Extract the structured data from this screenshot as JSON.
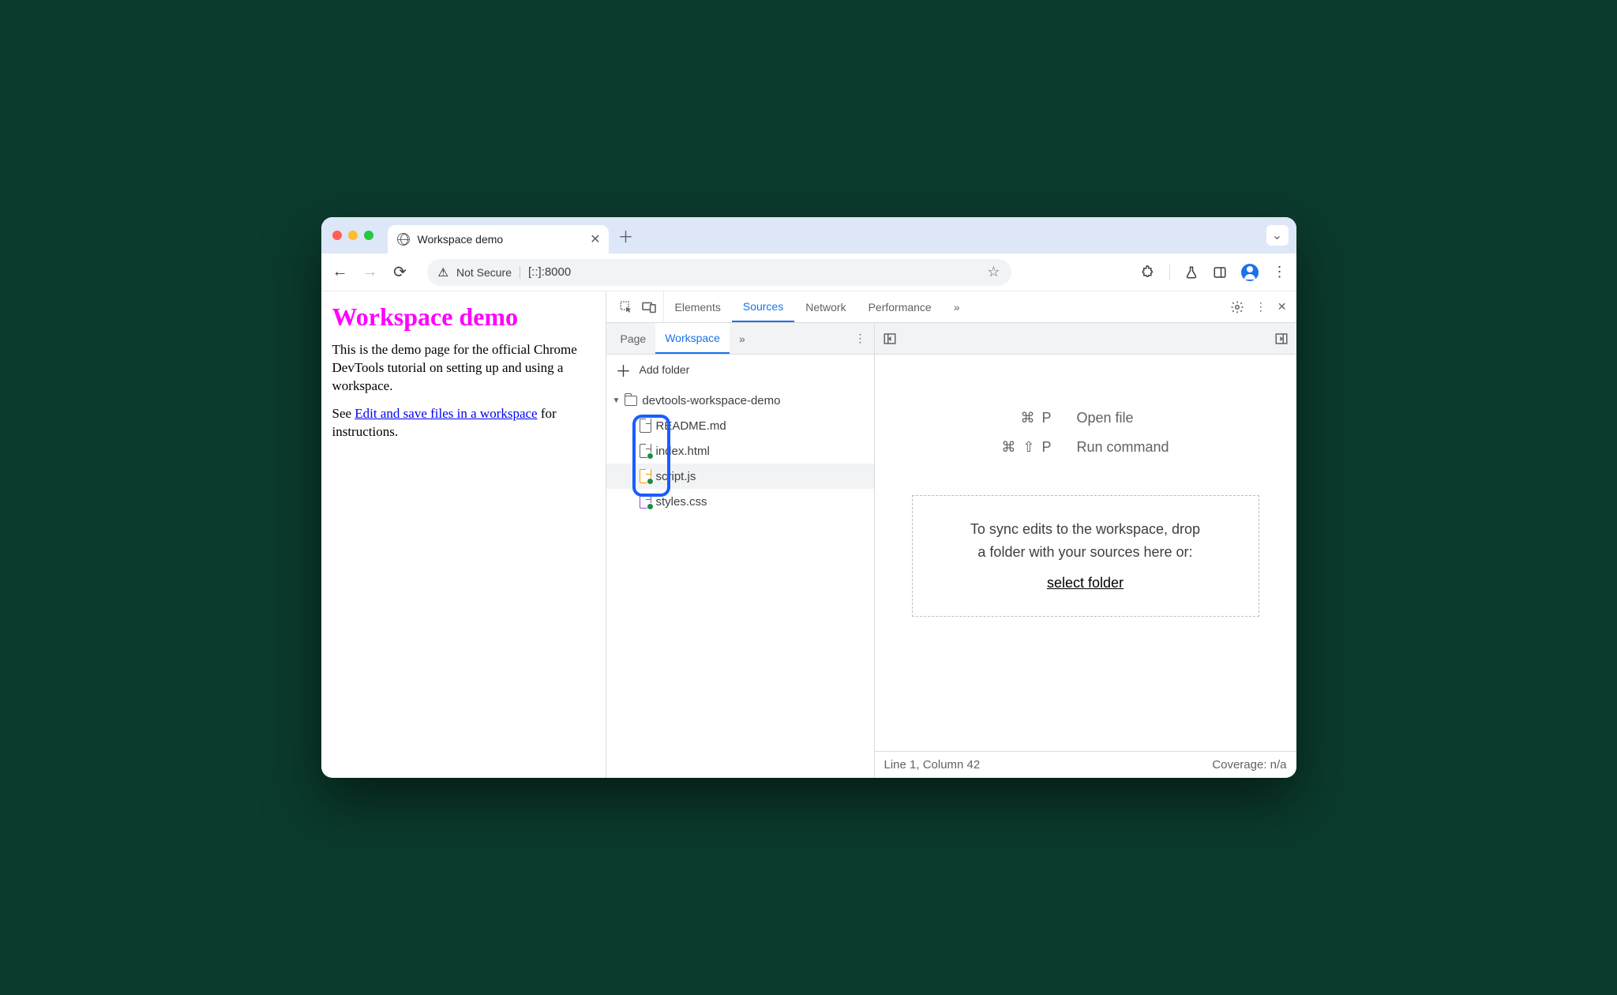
{
  "browser": {
    "tab_title": "Workspace demo",
    "not_secure": "Not Secure",
    "url": "[::]:8000"
  },
  "page": {
    "heading": "Workspace demo",
    "paragraph": "This is the demo page for the official Chrome DevTools tutorial on setting up and using a workspace.",
    "see_prefix": "See ",
    "link_text": "Edit and save files in a workspace",
    "see_suffix": " for instructions."
  },
  "devtools": {
    "tabs": {
      "elements": "Elements",
      "sources": "Sources",
      "network": "Network",
      "performance": "Performance"
    },
    "sources": {
      "nav": {
        "page": "Page",
        "workspace": "Workspace",
        "add_folder": "Add folder"
      },
      "tree": {
        "folder": "devtools-workspace-demo",
        "files": [
          "README.md",
          "index.html",
          "script.js",
          "styles.css"
        ]
      },
      "shortcuts": {
        "open_key": "⌘ P",
        "open_label": "Open file",
        "run_key": "⌘ ⇧ P",
        "run_label": "Run command"
      },
      "drop": {
        "line1": "To sync edits to the workspace, drop",
        "line2": "a folder with your sources here or:",
        "link": "select folder"
      },
      "status": {
        "pos": "Line 1, Column 42",
        "cov": "Coverage: n/a"
      }
    }
  }
}
